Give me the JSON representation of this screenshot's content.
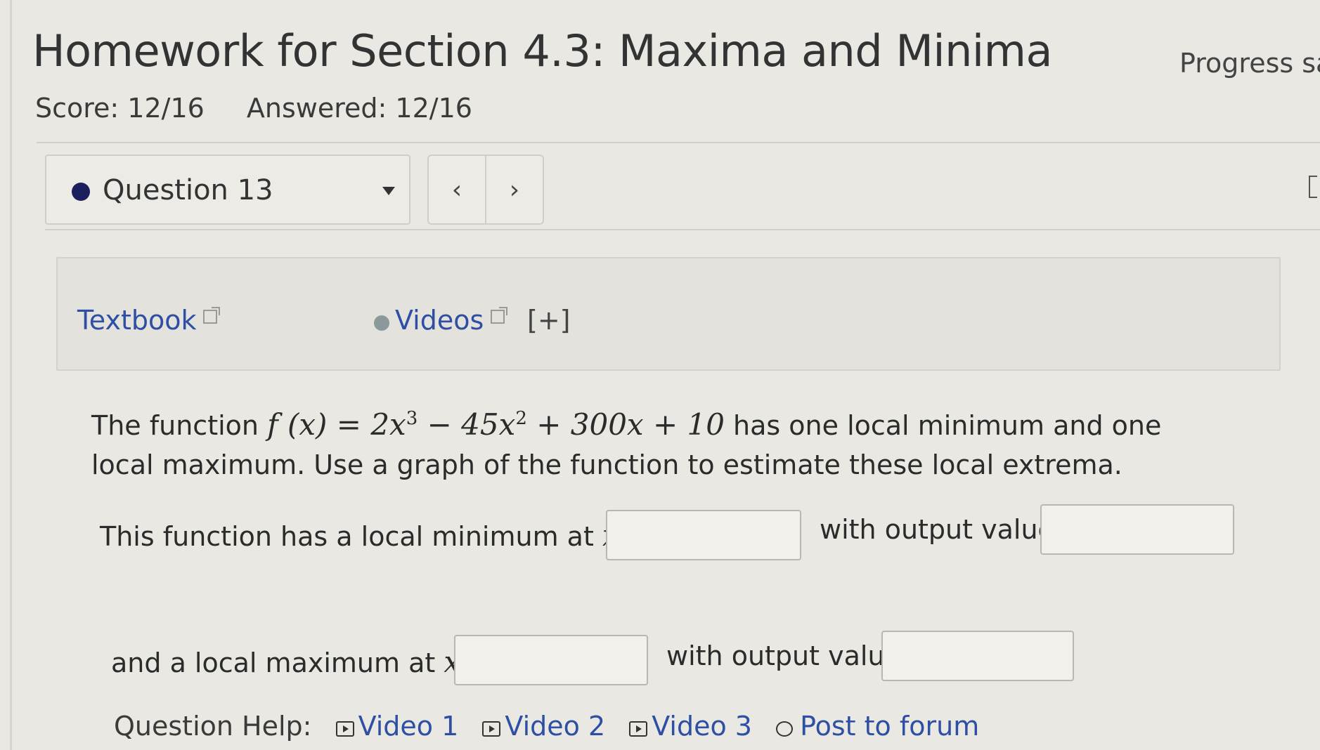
{
  "header": {
    "title": "Homework for Section 4.3: Maxima and Minima",
    "progress_label": "Progress sa",
    "score": "Score: 12/16",
    "answered": "Answered: 12/16"
  },
  "question_nav": {
    "current": "Question 13",
    "prev_glyph": "‹",
    "next_glyph": "›"
  },
  "resources": {
    "textbook": "Textbook",
    "videos": "Videos",
    "expand": "[+]"
  },
  "problem": {
    "intro": "The function",
    "func_lhs": "f (x) = 2x",
    "exp1": "3",
    "mid": " − 45x",
    "exp2": "2",
    "tail": " + 300x + 10",
    "rest": " has one local minimum and one local maximum. Use a graph of the function to estimate these local extrema."
  },
  "answers": {
    "min_prefix": "This function has a local minimum at",
    "max_prefix": "and a local maximum at",
    "var_eq": "x =",
    "with_output": "with output value"
  },
  "help": {
    "label": "Question Help:",
    "video1": "Video 1",
    "video2": "Video 2",
    "video3": "Video 3",
    "forum": "Post to forum"
  }
}
